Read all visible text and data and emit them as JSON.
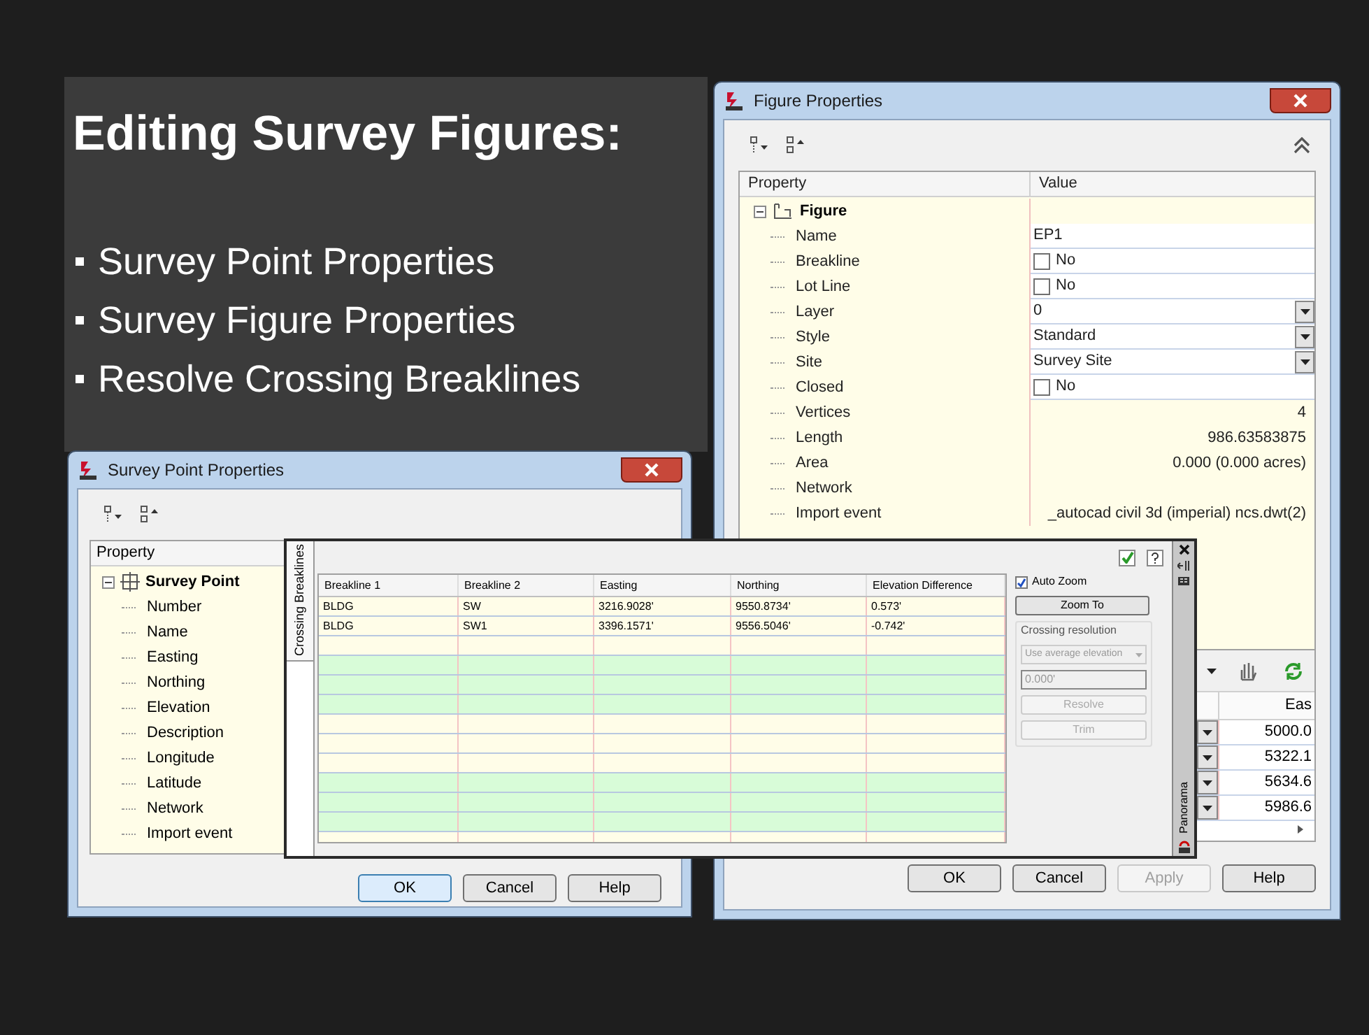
{
  "slide": {
    "title": "Editing Survey Figures:",
    "bullets": [
      "Survey Point Properties",
      "Survey Figure Properties",
      "Resolve Crossing Breaklines"
    ]
  },
  "figure_properties": {
    "title": "Figure Properties",
    "columns": [
      "Property",
      "Value"
    ],
    "group": "Figure",
    "group_expanded": true,
    "rows": [
      {
        "label": "Name",
        "kind": "text",
        "value": "EP1"
      },
      {
        "label": "Breakline",
        "kind": "checkbox",
        "checked": false,
        "value": "No"
      },
      {
        "label": "Lot Line",
        "kind": "checkbox",
        "checked": false,
        "value": "No"
      },
      {
        "label": "Layer",
        "kind": "dropdown",
        "value": "0"
      },
      {
        "label": "Style",
        "kind": "dropdown",
        "value": "Standard"
      },
      {
        "label": "Site",
        "kind": "dropdown",
        "value": "Survey Site"
      },
      {
        "label": "Closed",
        "kind": "checkbox",
        "checked": false,
        "value": "No"
      },
      {
        "label": "Vertices",
        "kind": "readout",
        "value": "4"
      },
      {
        "label": "Length",
        "kind": "readout",
        "value": "986.63583875"
      },
      {
        "label": "Area",
        "kind": "readout",
        "value": "0.000 (0.000 acres)"
      },
      {
        "label": "Network",
        "kind": "readout"
      },
      {
        "label": "Import event",
        "kind": "readout",
        "value": "_autocad civil 3d (imperial) ncs.dwt(2)"
      }
    ],
    "lower_grid": {
      "column": "Eas",
      "rows": [
        "5000.0",
        "5322.1",
        "5634.6",
        "5986.6"
      ]
    },
    "buttons": [
      {
        "label": "OK",
        "disabled": false,
        "default": false
      },
      {
        "label": "Cancel",
        "disabled": false,
        "default": false
      },
      {
        "label": "Apply",
        "disabled": true,
        "default": false
      },
      {
        "label": "Help",
        "disabled": false,
        "default": false
      }
    ]
  },
  "survey_point_properties": {
    "title": "Survey Point Properties",
    "column": "Property",
    "group": "Survey Point",
    "group_expanded": true,
    "rows": [
      "Number",
      "Name",
      "Easting",
      "Northing",
      "Elevation",
      "Description",
      "Longitude",
      "Latitude",
      "Network",
      "Import event"
    ],
    "buttons": [
      {
        "label": "OK",
        "disabled": false,
        "default": true
      },
      {
        "label": "Cancel",
        "disabled": false,
        "default": false
      },
      {
        "label": "Help",
        "disabled": false,
        "default": false
      }
    ]
  },
  "panorama": {
    "tab": "Crossing Breaklines",
    "columns": [
      "Breakline 1",
      "Breakline 2",
      "Easting",
      "Northing",
      "Elevation Difference"
    ],
    "rows": [
      [
        "BLDG",
        "SW",
        "3216.9028'",
        "9550.8734'",
        "0.573'"
      ],
      [
        "BLDG",
        "SW1",
        "3396.1571'",
        "9556.5046'",
        "-0.742'"
      ]
    ],
    "auto_zoom": {
      "label": "Auto Zoom",
      "checked": true
    },
    "zoom_to": "Zoom To",
    "resolution": {
      "legend": "Crossing resolution",
      "method": "Use average elevation",
      "value": "0.000'",
      "disabled": true,
      "buttons": [
        "Resolve",
        "Trim"
      ]
    },
    "side_label": "Panorama"
  }
}
